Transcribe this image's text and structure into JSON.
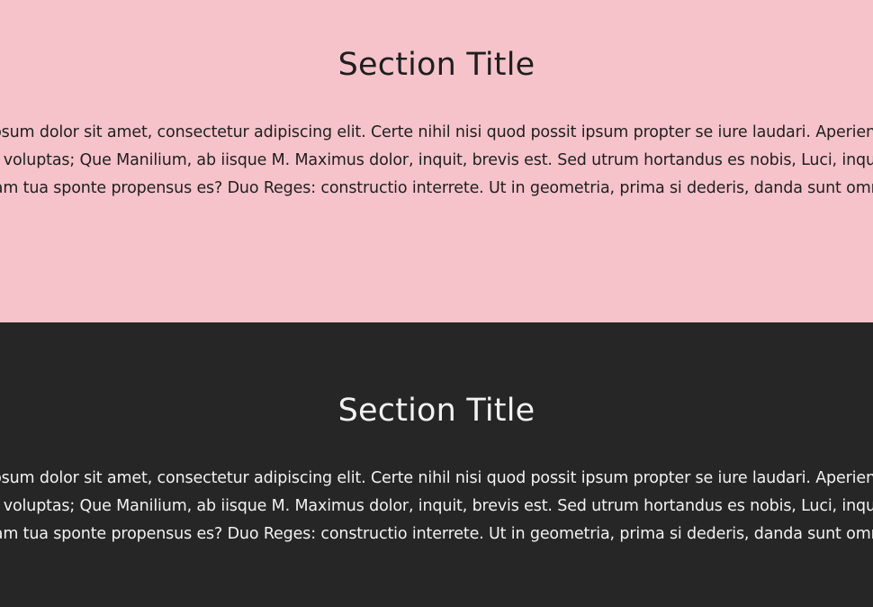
{
  "colors": {
    "pink_section_bg": "#f6c3cb",
    "pink_section_text": "#1f1f1f",
    "dark_section_bg": "#262626",
    "dark_section_text": "#f2f2f2"
  },
  "sections": [
    {
      "title": "Section Title",
      "lines": [
        "Lorem ipsum dolor sit amet, consectetur adipiscing elit. Certe nihil nisi quod possit ipsum propter se iure laudari. Aperiendum est",
        "igitur voluptas; Que Manilium, ab iisque M. Maximus dolor, inquit, brevis est. Sed utrum hortandus es nobis, Luci, inquit, an",
        "etiam tua sponte propensus es? Duo Reges: constructio interrete. Ut in geometria, prima si dederis, danda sunt omnia."
      ]
    },
    {
      "title": "Section Title",
      "lines": [
        "Lorem ipsum dolor sit amet, consectetur adipiscing elit. Certe nihil nisi quod possit ipsum propter se iure laudari. Aperiendum est",
        "igitur voluptas; Que Manilium, ab iisque M. Maximus dolor, inquit, brevis est. Sed utrum hortandus es nobis, Luci, inquit, an",
        "etiam tua sponte propensus es? Duo Reges: constructio interrete. Ut in geometria, prima si dederis, danda sunt omnia."
      ]
    }
  ]
}
